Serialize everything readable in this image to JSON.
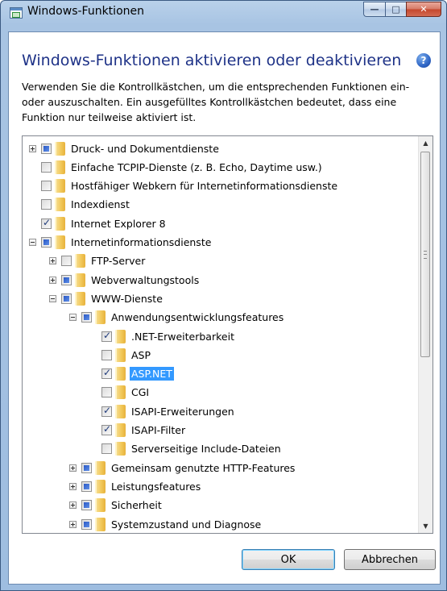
{
  "window": {
    "title": "Windows-Funktionen",
    "controls": {
      "minimize": "—",
      "maximize": "□",
      "close": "✕"
    }
  },
  "header": {
    "title": "Windows-Funktionen aktivieren oder deaktivieren",
    "help_icon": "?"
  },
  "description": "Verwenden Sie die Kontrollkästchen, um die entsprechenden Funktionen ein- oder auszuschalten. Ein ausgefülltes Kontrollkästchen bedeutet, dass eine Funktion nur teilweise aktiviert ist.",
  "features": [
    {
      "label": "Druck- und Dokumentdienste",
      "level": 0,
      "expander": "plus",
      "state": "partial"
    },
    {
      "label": "Einfache TCPIP-Dienste (z. B. Echo, Daytime usw.)",
      "level": 0,
      "expander": "none",
      "state": "unchecked"
    },
    {
      "label": "Hostfähiger Webkern für Internetinformationsdienste",
      "level": 0,
      "expander": "none",
      "state": "unchecked"
    },
    {
      "label": "Indexdienst",
      "level": 0,
      "expander": "none",
      "state": "unchecked"
    },
    {
      "label": "Internet Explorer 8",
      "level": 0,
      "expander": "none",
      "state": "checked"
    },
    {
      "label": "Internetinformationsdienste",
      "level": 0,
      "expander": "minus",
      "state": "partial"
    },
    {
      "label": "FTP-Server",
      "level": 1,
      "expander": "plus",
      "state": "unchecked"
    },
    {
      "label": "Webverwaltungstools",
      "level": 1,
      "expander": "plus",
      "state": "partial"
    },
    {
      "label": "WWW-Dienste",
      "level": 1,
      "expander": "minus",
      "state": "partial"
    },
    {
      "label": "Anwendungsentwicklungsfeatures",
      "level": 2,
      "expander": "minus",
      "state": "partial"
    },
    {
      "label": ".NET-Erweiterbarkeit",
      "level": 3,
      "expander": "none",
      "state": "checked"
    },
    {
      "label": "ASP",
      "level": 3,
      "expander": "none",
      "state": "unchecked"
    },
    {
      "label": "ASP.NET",
      "level": 3,
      "expander": "none",
      "state": "checked",
      "selected": true
    },
    {
      "label": "CGI",
      "level": 3,
      "expander": "none",
      "state": "unchecked"
    },
    {
      "label": "ISAPI-Erweiterungen",
      "level": 3,
      "expander": "none",
      "state": "checked"
    },
    {
      "label": "ISAPI-Filter",
      "level": 3,
      "expander": "none",
      "state": "checked"
    },
    {
      "label": "Serverseitige Include-Dateien",
      "level": 3,
      "expander": "none",
      "state": "unchecked"
    },
    {
      "label": "Gemeinsam genutzte HTTP-Features",
      "level": 2,
      "expander": "plus",
      "state": "partial"
    },
    {
      "label": "Leistungsfeatures",
      "level": 2,
      "expander": "plus",
      "state": "partial"
    },
    {
      "label": "Sicherheit",
      "level": 2,
      "expander": "plus",
      "state": "partial"
    },
    {
      "label": "Systemzustand und Diagnose",
      "level": 2,
      "expander": "plus",
      "state": "partial"
    }
  ],
  "buttons": {
    "ok": "OK",
    "cancel": "Abbrechen"
  },
  "icons": {
    "app": "windows-features-icon",
    "help": "help-icon",
    "folder": "folder-icon",
    "expand": "plus-icon",
    "collapse": "minus-icon"
  }
}
